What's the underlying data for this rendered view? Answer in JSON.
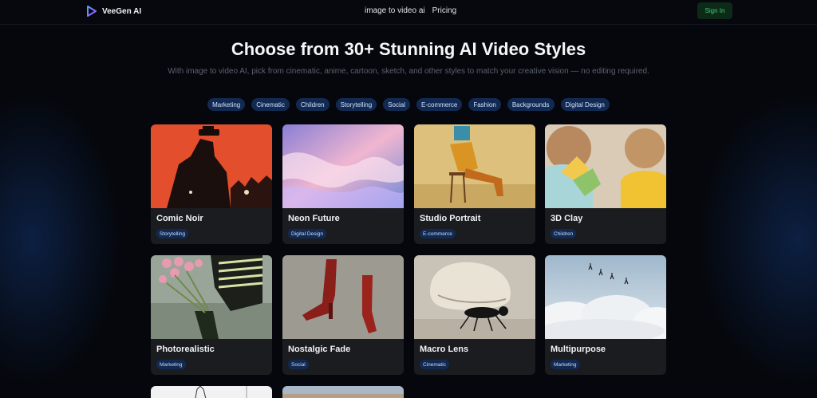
{
  "header": {
    "brand_name": "VeeGen AI",
    "nav": [
      {
        "label": "image to video ai"
      },
      {
        "label": "Pricing"
      }
    ],
    "signin_label": "Sign In"
  },
  "hero": {
    "title": "Choose from 30+ Stunning AI Video Styles",
    "subtitle": "With image to video AI, pick from cinematic, anime, cartoon, sketch, and other styles to match your creative vision — no editing required."
  },
  "filter_tags": [
    "Marketing",
    "Cinematic",
    "Children",
    "Storytelling",
    "Social",
    "E-commerce",
    "Fashion",
    "Backgrounds",
    "Digital Design"
  ],
  "cards": [
    {
      "title": "Comic Noir",
      "tag": "Storytelling"
    },
    {
      "title": "Neon Future",
      "tag": "Digital Design"
    },
    {
      "title": "Studio Portrait",
      "tag": "E-commerce"
    },
    {
      "title": "3D Clay",
      "tag": "Children"
    },
    {
      "title": "Photorealistic",
      "tag": "Marketing"
    },
    {
      "title": "Nostalgic Fade",
      "tag": "Social"
    },
    {
      "title": "Macro Lens",
      "tag": "Cinematic"
    },
    {
      "title": "Multipurpose",
      "tag": "Marketing"
    }
  ],
  "colors": {
    "accent_tag_bg": "#122a52",
    "signin_bg": "#0d2a18",
    "signin_text": "#3fcf76",
    "card_bg": "#1b1c20"
  }
}
